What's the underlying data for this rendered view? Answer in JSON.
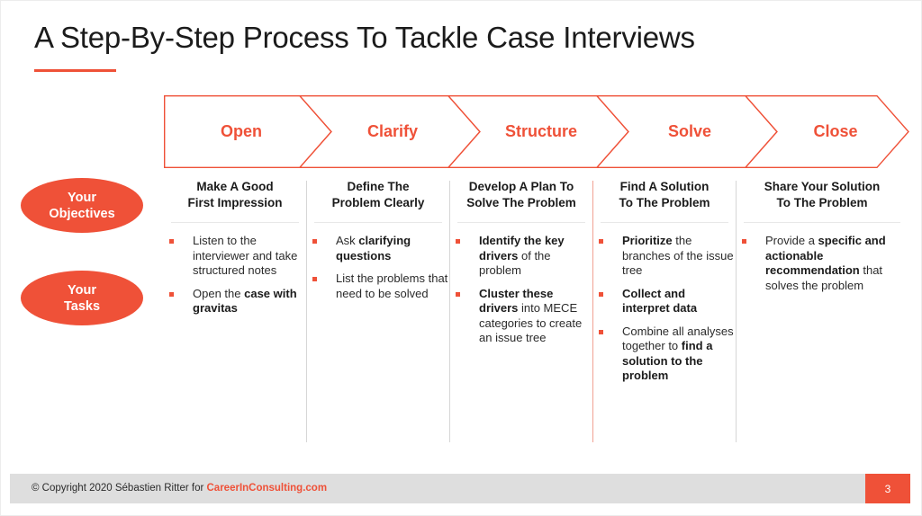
{
  "slide": {
    "title": "A Step-By-Step Process To Tackle Case Interviews",
    "accent_color": "#ef5138",
    "page_number": "3"
  },
  "process_bar": {
    "steps": [
      {
        "label": "Open"
      },
      {
        "label": "Clarify"
      },
      {
        "label": "Structure"
      },
      {
        "label": "Solve"
      },
      {
        "label": "Close"
      }
    ]
  },
  "row_labels": [
    {
      "line1": "Your",
      "line2": "Objectives"
    },
    {
      "line1": "Your",
      "line2": "Tasks"
    }
  ],
  "columns": [
    {
      "heading_line1": "Make A Good",
      "heading_line2": "First Impression",
      "bullets": [
        {
          "parts": [
            {
              "text": "Listen to the interviewer and take structured notes",
              "bold": false
            }
          ]
        },
        {
          "parts": [
            {
              "text": "Open the ",
              "bold": false
            },
            {
              "text": "case with gravitas",
              "bold": true
            }
          ]
        }
      ]
    },
    {
      "heading_line1": "Define The",
      "heading_line2": "Problem Clearly",
      "bullets": [
        {
          "parts": [
            {
              "text": "Ask ",
              "bold": false
            },
            {
              "text": "clarifying questions",
              "bold": true
            }
          ]
        },
        {
          "parts": [
            {
              "text": "List the problems that need to be solved",
              "bold": false
            }
          ]
        }
      ]
    },
    {
      "heading_line1": "Develop A Plan To",
      "heading_line2": "Solve The Problem",
      "bullets": [
        {
          "parts": [
            {
              "text": "Identify the key drivers",
              "bold": true
            },
            {
              "text": " of the problem",
              "bold": false
            }
          ]
        },
        {
          "parts": [
            {
              "text": "Cluster these drivers",
              "bold": true
            },
            {
              "text": " into MECE categories to create an issue tree",
              "bold": false
            }
          ]
        }
      ]
    },
    {
      "heading_line1": "Find A Solution",
      "heading_line2": "To The Problem",
      "bullets": [
        {
          "parts": [
            {
              "text": "Prioritize",
              "bold": true
            },
            {
              "text": " the branches of the issue tree",
              "bold": false
            }
          ]
        },
        {
          "parts": [
            {
              "text": "Collect and interpret data",
              "bold": true
            }
          ]
        },
        {
          "parts": [
            {
              "text": "Combine all analyses together to ",
              "bold": false
            },
            {
              "text": "find a solution to the problem",
              "bold": true
            }
          ]
        }
      ]
    },
    {
      "heading_line1": "Share Your Solution",
      "heading_line2": "To The Problem",
      "bullets": [
        {
          "parts": [
            {
              "text": "Provide a ",
              "bold": false
            },
            {
              "text": "specific and actionable recommendation",
              "bold": true
            },
            {
              "text": " that solves the problem",
              "bold": false
            }
          ]
        }
      ]
    }
  ],
  "footer": {
    "copyright": "© Copyright 2020 Sébastien Ritter for ",
    "brand": "CareerInConsulting.com"
  }
}
